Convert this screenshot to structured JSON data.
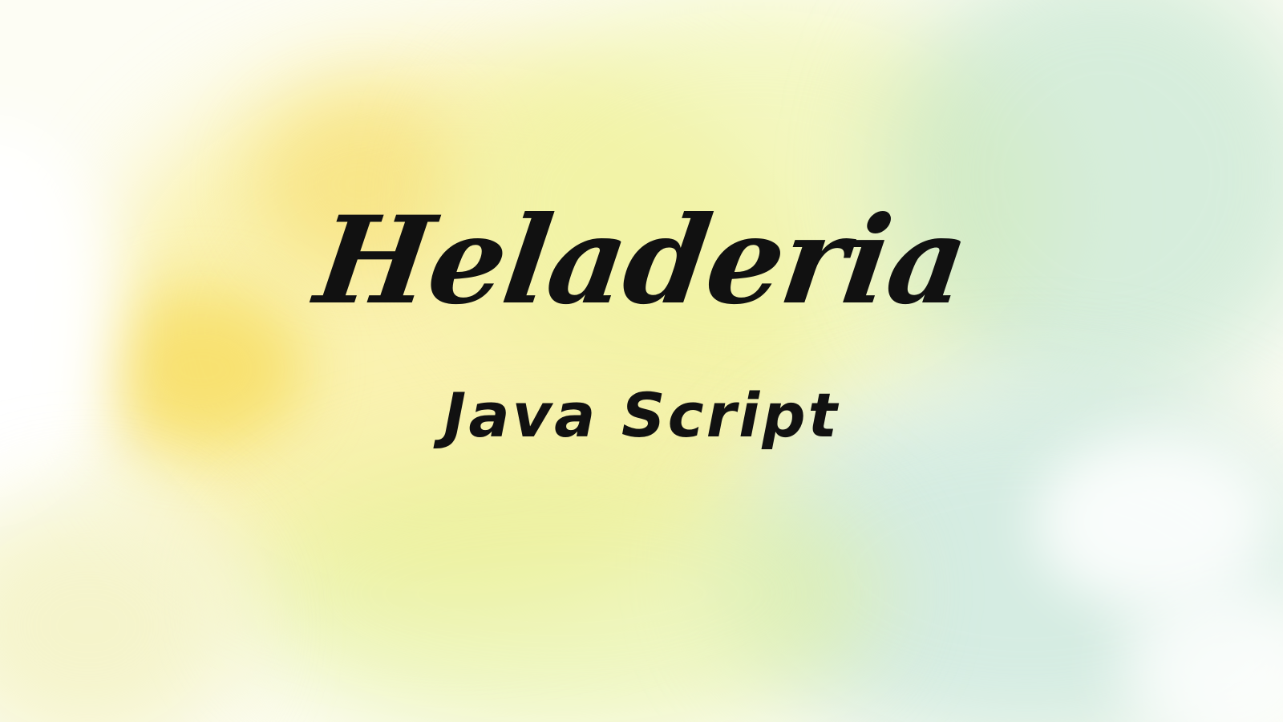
{
  "slide": {
    "title": "Heladeria",
    "subtitle": "Java Script"
  },
  "colors": {
    "text": "#111111",
    "wash_yellow": "#f5d43c",
    "wash_lime": "#ecf3a0",
    "wash_mint": "#b4ded4"
  }
}
